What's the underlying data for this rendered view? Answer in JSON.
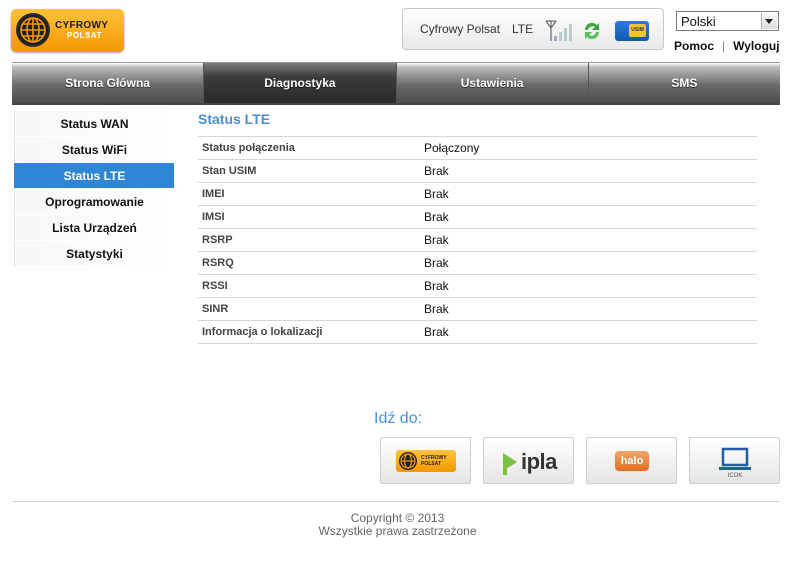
{
  "header": {
    "logo": {
      "line1": "CYFROWY",
      "line2": "POLSAT"
    },
    "status": {
      "operator": "Cyfrowy Polsat",
      "network": "LTE",
      "signal_icon": "signal-bars-icon",
      "refresh_icon": "refresh-icon",
      "sim_label": "USIM"
    },
    "language": {
      "selected": "Polski"
    },
    "links": {
      "help": "Pomoc",
      "logout": "Wyloguj"
    }
  },
  "nav": {
    "tabs": [
      {
        "label": "Strona Główna",
        "active": false
      },
      {
        "label": "Diagnostyka",
        "active": true
      },
      {
        "label": "Ustawienia",
        "active": false
      },
      {
        "label": "SMS",
        "active": false
      }
    ]
  },
  "sidebar": {
    "items": [
      {
        "label": "Status WAN",
        "active": false
      },
      {
        "label": "Status WiFi",
        "active": false
      },
      {
        "label": "Status LTE",
        "active": true
      },
      {
        "label": "Oprogramowanie",
        "active": false
      },
      {
        "label": "Lista Urządzeń",
        "active": false
      },
      {
        "label": "Statystyki",
        "active": false
      }
    ]
  },
  "main": {
    "title": "Status LTE",
    "rows": [
      {
        "key": "Status połączenia",
        "value": "Połączony"
      },
      {
        "key": "Stan USIM",
        "value": "Brak"
      },
      {
        "key": "IMEI",
        "value": "Brak"
      },
      {
        "key": "IMSI",
        "value": "Brak"
      },
      {
        "key": "RSRP",
        "value": "Brak"
      },
      {
        "key": "RSRQ",
        "value": "Brak"
      },
      {
        "key": "RSSI",
        "value": "Brak"
      },
      {
        "key": "SINR",
        "value": "Brak"
      },
      {
        "key": "Informacja o lokalizacji",
        "value": "Brak"
      }
    ]
  },
  "shortcuts": {
    "label": "Idź do:",
    "items": {
      "cp": {
        "line1": "CYFROWY",
        "line2": "POLSAT"
      },
      "ipla": {
        "text": "ipla"
      },
      "halo": {
        "text": "halo"
      },
      "icok": {
        "text": "ICOK"
      }
    }
  },
  "footer": {
    "copyright": "Copyright © 2013",
    "rights": "Wszystkie prawa zastrzeżone"
  },
  "colors": {
    "accent": "#2f86d6",
    "title": "#4a8fd6",
    "brand_orange": "#f39800"
  }
}
